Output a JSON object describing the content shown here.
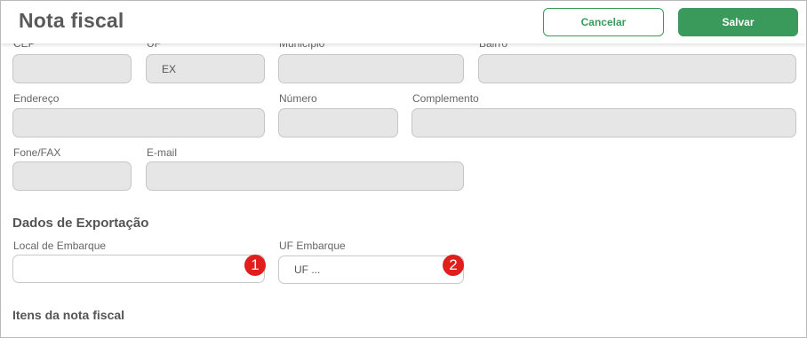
{
  "header": {
    "title": "Nota fiscal",
    "cancel_label": "Cancelar",
    "save_label": "Salvar"
  },
  "address": {
    "cep_label": "CEP",
    "cep_value": "",
    "uf_label": "UF",
    "uf_value": "EX",
    "municipio_label": "Município",
    "municipio_value": "",
    "bairro_label": "Bairro",
    "bairro_value": "",
    "endereco_label": "Endereço",
    "endereco_value": "",
    "numero_label": "Número",
    "numero_value": "",
    "complemento_label": "Complemento",
    "complemento_value": "",
    "fone_label": "Fone/FAX",
    "fone_value": "",
    "email_label": "E-mail",
    "email_value": ""
  },
  "export": {
    "section_title": "Dados de Exportação",
    "local_label": "Local de Embarque",
    "local_value": "",
    "uf_label": "UF Embarque",
    "uf_placeholder": "UF ..."
  },
  "items": {
    "section_title": "Itens da nota fiscal"
  },
  "markers": [
    "1",
    "2"
  ],
  "colors": {
    "brand_green": "#3a9a5b",
    "marker_red": "#e01e1e"
  }
}
